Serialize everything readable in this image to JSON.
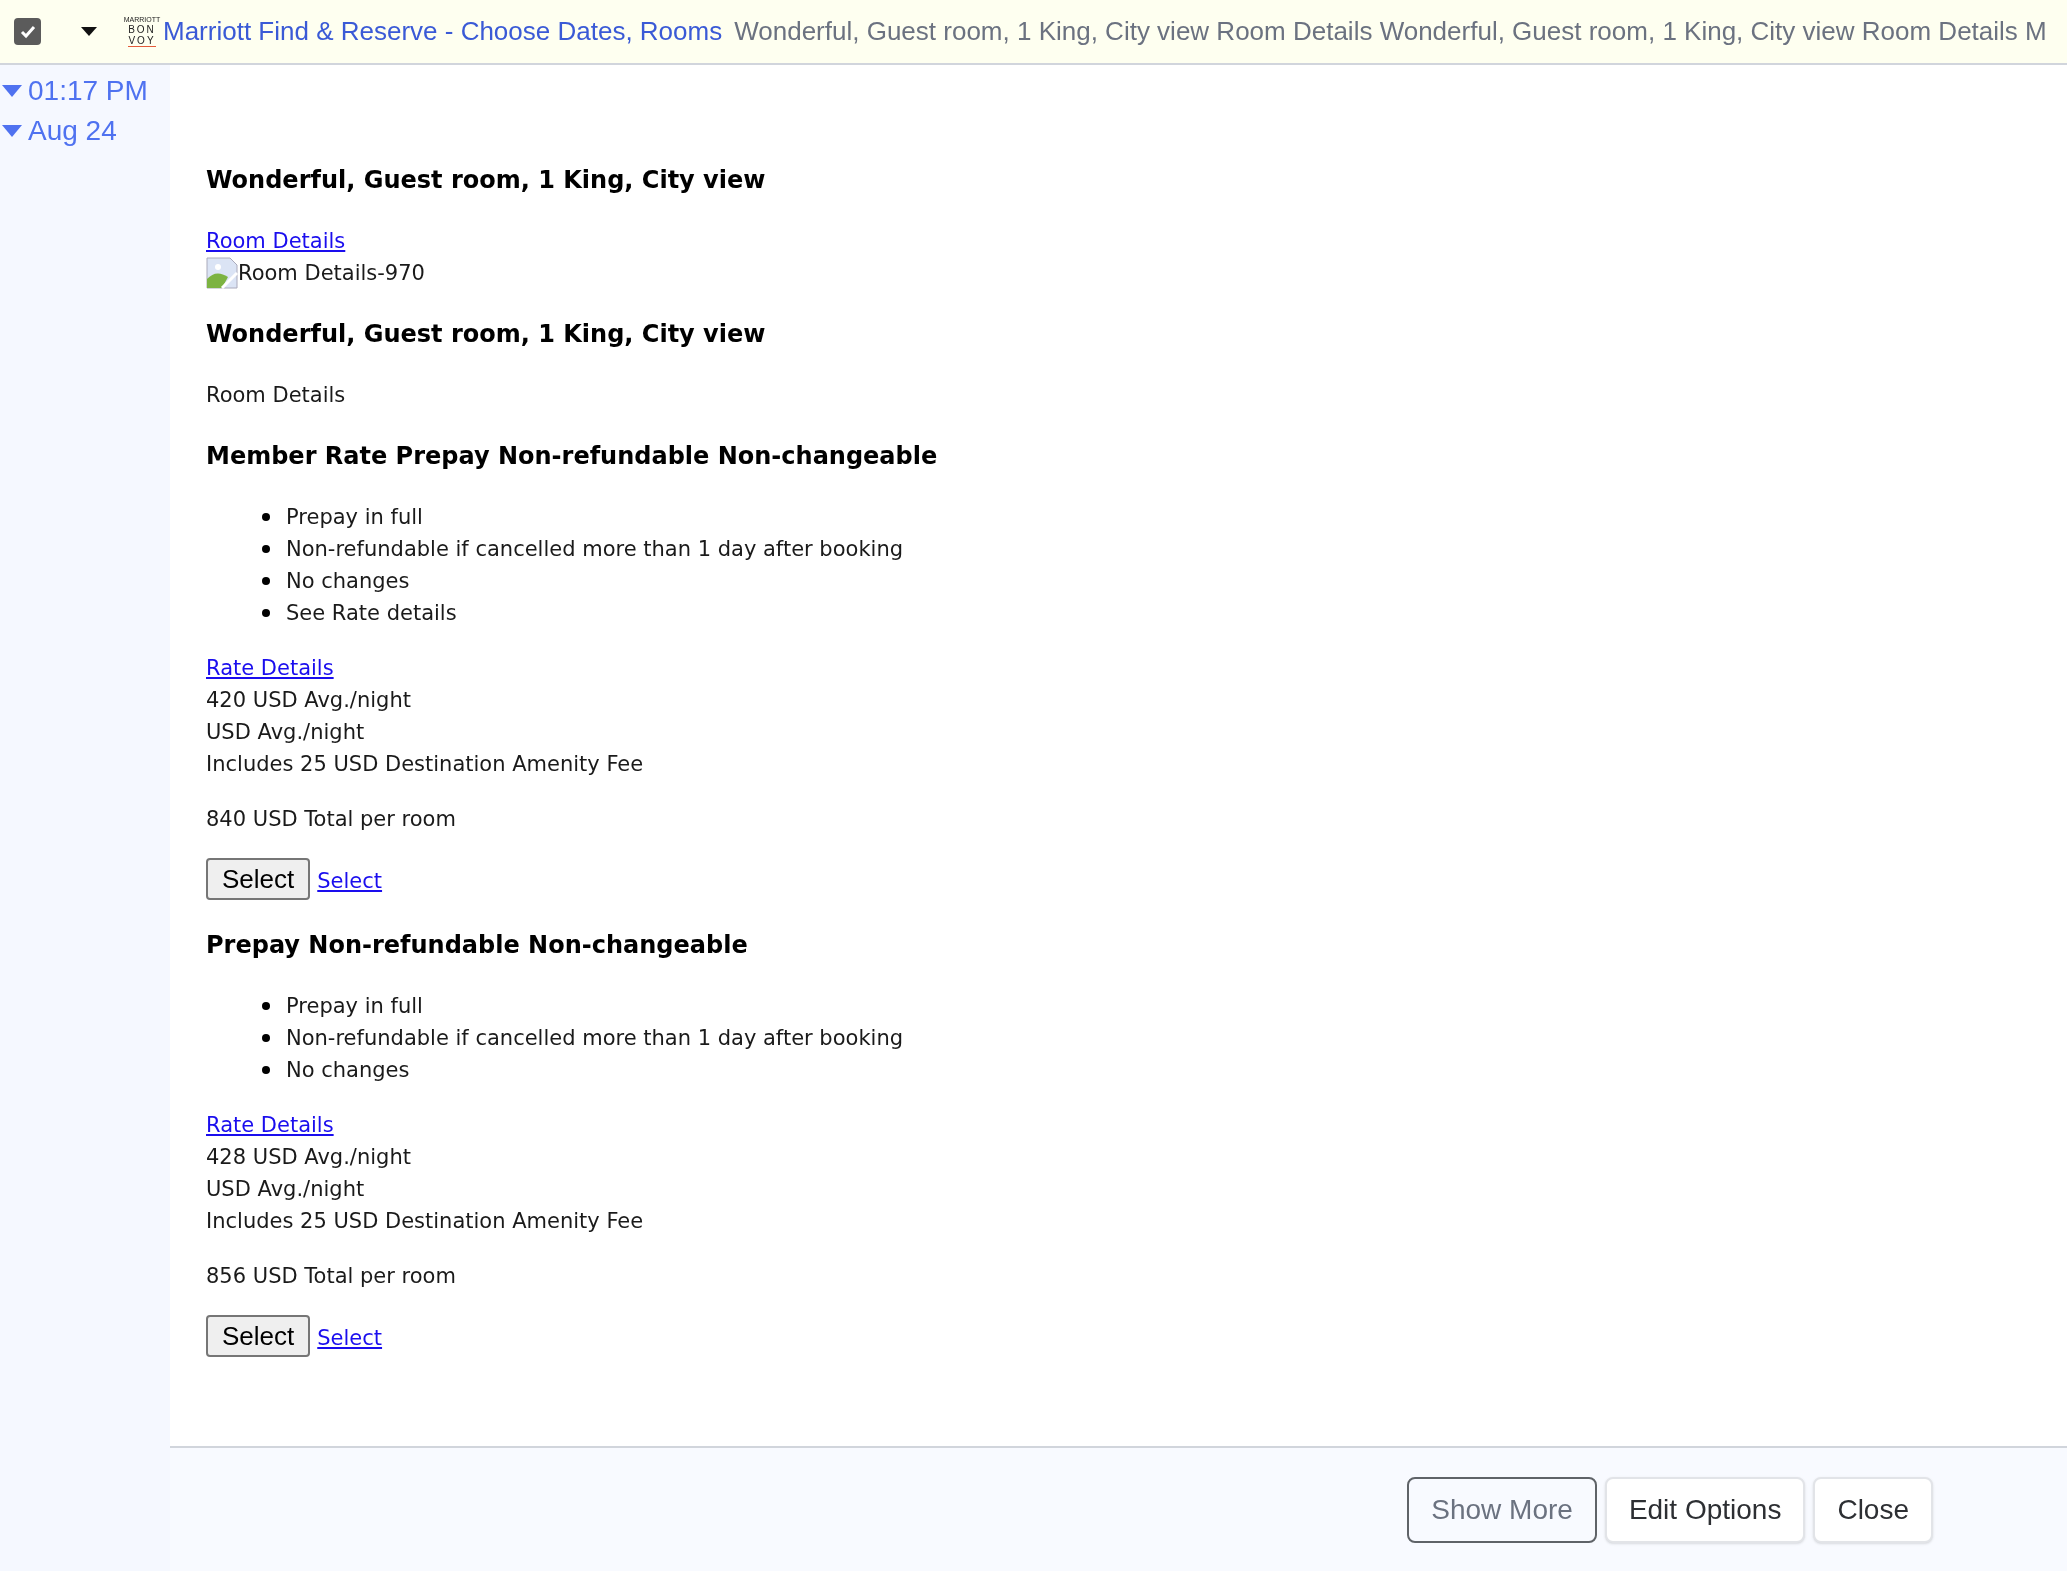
{
  "header": {
    "checked": true,
    "logo": [
      "MARRIOTT",
      "BON",
      "VOY"
    ],
    "title": "Marriott Find & Reserve - Choose Dates, Rooms",
    "snippet": "Wonderful, Guest room, 1 King, City view Room Details Wonderful, Guest room, 1 King, City view Room Details M"
  },
  "timeline": [
    {
      "label": "01:17 PM",
      "expanded": true
    },
    {
      "label": "Aug 24",
      "expanded": true
    }
  ],
  "content": [
    {
      "kind": "heading",
      "text": "Wonderful, Guest room, 1 King, City view"
    },
    {
      "kind": "lines",
      "items": [
        {
          "kind": "link",
          "text": "Room Details"
        },
        {
          "kind": "image",
          "text": "Room Details-970"
        }
      ]
    },
    {
      "kind": "heading",
      "text": "Wonderful, Guest room, 1 King, City view"
    },
    {
      "kind": "text",
      "text": "Room Details"
    },
    {
      "kind": "heading",
      "text": "Member Rate Prepay Non-refundable Non-changeable"
    },
    {
      "kind": "list",
      "items": [
        "Prepay in full",
        "Non-refundable if cancelled more than 1 day after booking",
        "No changes",
        "See Rate details"
      ]
    },
    {
      "kind": "lines",
      "items": [
        {
          "kind": "link",
          "text": "Rate Details"
        },
        {
          "kind": "text",
          "text": "420 USD Avg./night"
        },
        {
          "kind": "text",
          "text": "USD Avg./night"
        },
        {
          "kind": "text",
          "text": "Includes 25 USD Destination Amenity Fee"
        }
      ]
    },
    {
      "kind": "text",
      "text": "840 USD Total per room"
    },
    {
      "kind": "actions",
      "button": "Select",
      "link": "Select"
    },
    {
      "kind": "heading",
      "text": "Prepay Non-refundable Non-changeable"
    },
    {
      "kind": "list",
      "items": [
        "Prepay in full",
        "Non-refundable if cancelled more than 1 day after booking",
        "No changes"
      ]
    },
    {
      "kind": "lines",
      "items": [
        {
          "kind": "link",
          "text": "Rate Details"
        },
        {
          "kind": "text",
          "text": "428 USD Avg./night"
        },
        {
          "kind": "text",
          "text": "USD Avg./night"
        },
        {
          "kind": "text",
          "text": "Includes 25 USD Destination Amenity Fee"
        }
      ]
    },
    {
      "kind": "text",
      "text": "856 USD Total per room"
    },
    {
      "kind": "actions",
      "button": "Select",
      "link": "Select"
    }
  ],
  "footer_buttons": [
    {
      "label": "Show More",
      "kind": "outline"
    },
    {
      "label": "Edit Options",
      "kind": "default"
    },
    {
      "label": "Close",
      "kind": "default"
    }
  ]
}
